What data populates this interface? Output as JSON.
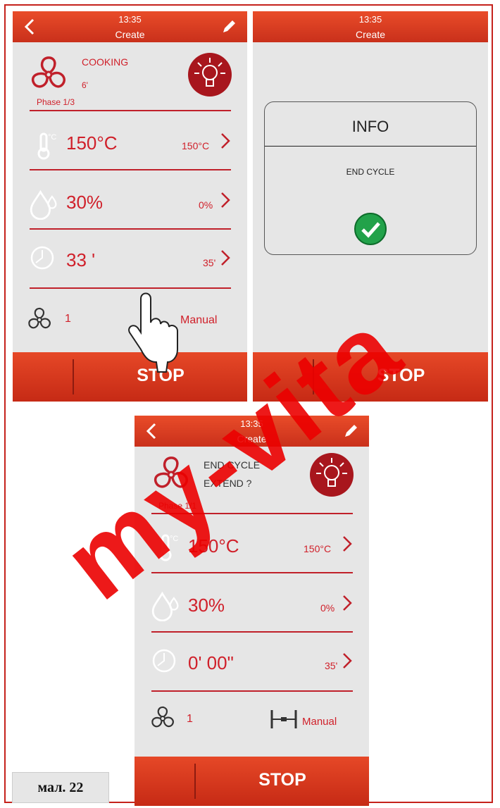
{
  "colors": {
    "accent": "#d0202a",
    "header": "#e04326",
    "screen_bg": "#e6e6e6",
    "watermark": "#eb0000"
  },
  "watermark": "my-vita",
  "caption": "мал. 22",
  "screen1": {
    "time": "13:35",
    "title": "Create",
    "status": "COOKING",
    "status_sub": "6'",
    "phase": "Phase 1/3",
    "rows": [
      {
        "icon": "thermometer-icon",
        "value": "150°C",
        "set": "150°C"
      },
      {
        "icon": "humidity-icon",
        "value": "30%",
        "set": "0%"
      },
      {
        "icon": "clock-icon",
        "value": "33 '",
        "set": "35'"
      }
    ],
    "fan_speed": "1",
    "mode": "Manual",
    "stop": "STOP"
  },
  "screen2": {
    "time": "13:35",
    "title": "Create",
    "dialog_title": "INFO",
    "dialog_message": "END CYCLE",
    "stop": "STOP"
  },
  "screen3": {
    "time": "13:35",
    "title": "Create",
    "status": "END CYCLE",
    "status_sub": "EXTEND ?",
    "phase": "Phase 1/1",
    "rows": [
      {
        "icon": "thermometer-icon",
        "value": "150°C",
        "set": "150°C"
      },
      {
        "icon": "humidity-icon",
        "value": "30%",
        "set": "0%"
      },
      {
        "icon": "clock-icon",
        "value": "0' 00\"",
        "set": "35'"
      }
    ],
    "fan_speed": "1",
    "mode": "Manual",
    "stop": "STOP"
  }
}
